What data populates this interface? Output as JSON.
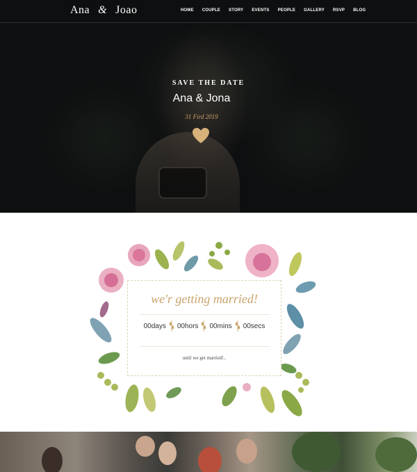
{
  "header": {
    "logo_first": "Ana",
    "logo_amp": "&",
    "logo_second": "Joao",
    "nav": [
      {
        "label": "HOME"
      },
      {
        "label": "COUPLE"
      },
      {
        "label": "STORY"
      },
      {
        "label": "EVENTS"
      },
      {
        "label": "PEOPLE"
      },
      {
        "label": "GALLERY"
      },
      {
        "label": "RSVP"
      },
      {
        "label": "BLOG"
      }
    ]
  },
  "hero": {
    "kicker": "SAVE THE DATE",
    "names": "Ana & Jona",
    "date": "31 Fird 2019",
    "icon": "heart-icon"
  },
  "countdown": {
    "title": "we'r getting married!",
    "days": "00days",
    "hours": "00hors",
    "mins": "00mins",
    "secs": "00secs",
    "footer": "until we get married!.."
  },
  "colors": {
    "gold": "#c8a46a",
    "hero_bg": "#0e0f10"
  }
}
